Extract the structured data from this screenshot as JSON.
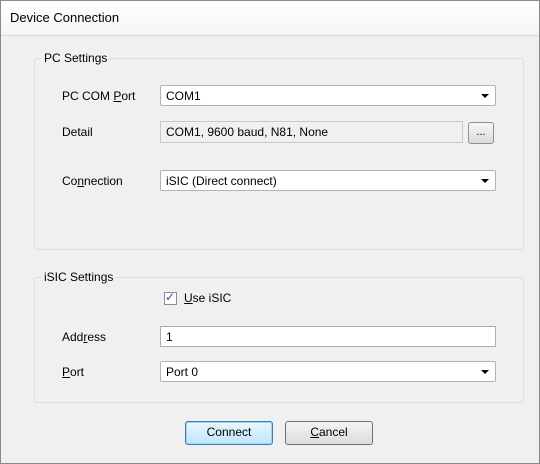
{
  "window": {
    "title": "Device Connection"
  },
  "pc_settings": {
    "group_label": "PC Settings",
    "com_port": {
      "label_prefix": "PC COM ",
      "label_accel": "P",
      "label_suffix": "ort",
      "value": "COM1"
    },
    "detail": {
      "label": "Detail",
      "value": "COM1, 9600 baud, N81, None",
      "button_label": "..."
    },
    "connection": {
      "label_prefix": "Co",
      "label_accel": "n",
      "label_suffix": "nection",
      "value": "iSIC (Direct connect)"
    }
  },
  "isic_settings": {
    "group_label": "iSIC Settings",
    "use_isic": {
      "label_accel": "U",
      "label_suffix": "se iSIC",
      "checked": true
    },
    "address": {
      "label_prefix": "Add",
      "label_accel": "r",
      "label_suffix": "ess",
      "value": "1"
    },
    "port": {
      "label_accel": "P",
      "label_suffix": "ort",
      "value": "Port 0"
    }
  },
  "buttons": {
    "connect": {
      "label": "Connect"
    },
    "cancel": {
      "label_accel": "C",
      "label_suffix": "ancel"
    }
  }
}
